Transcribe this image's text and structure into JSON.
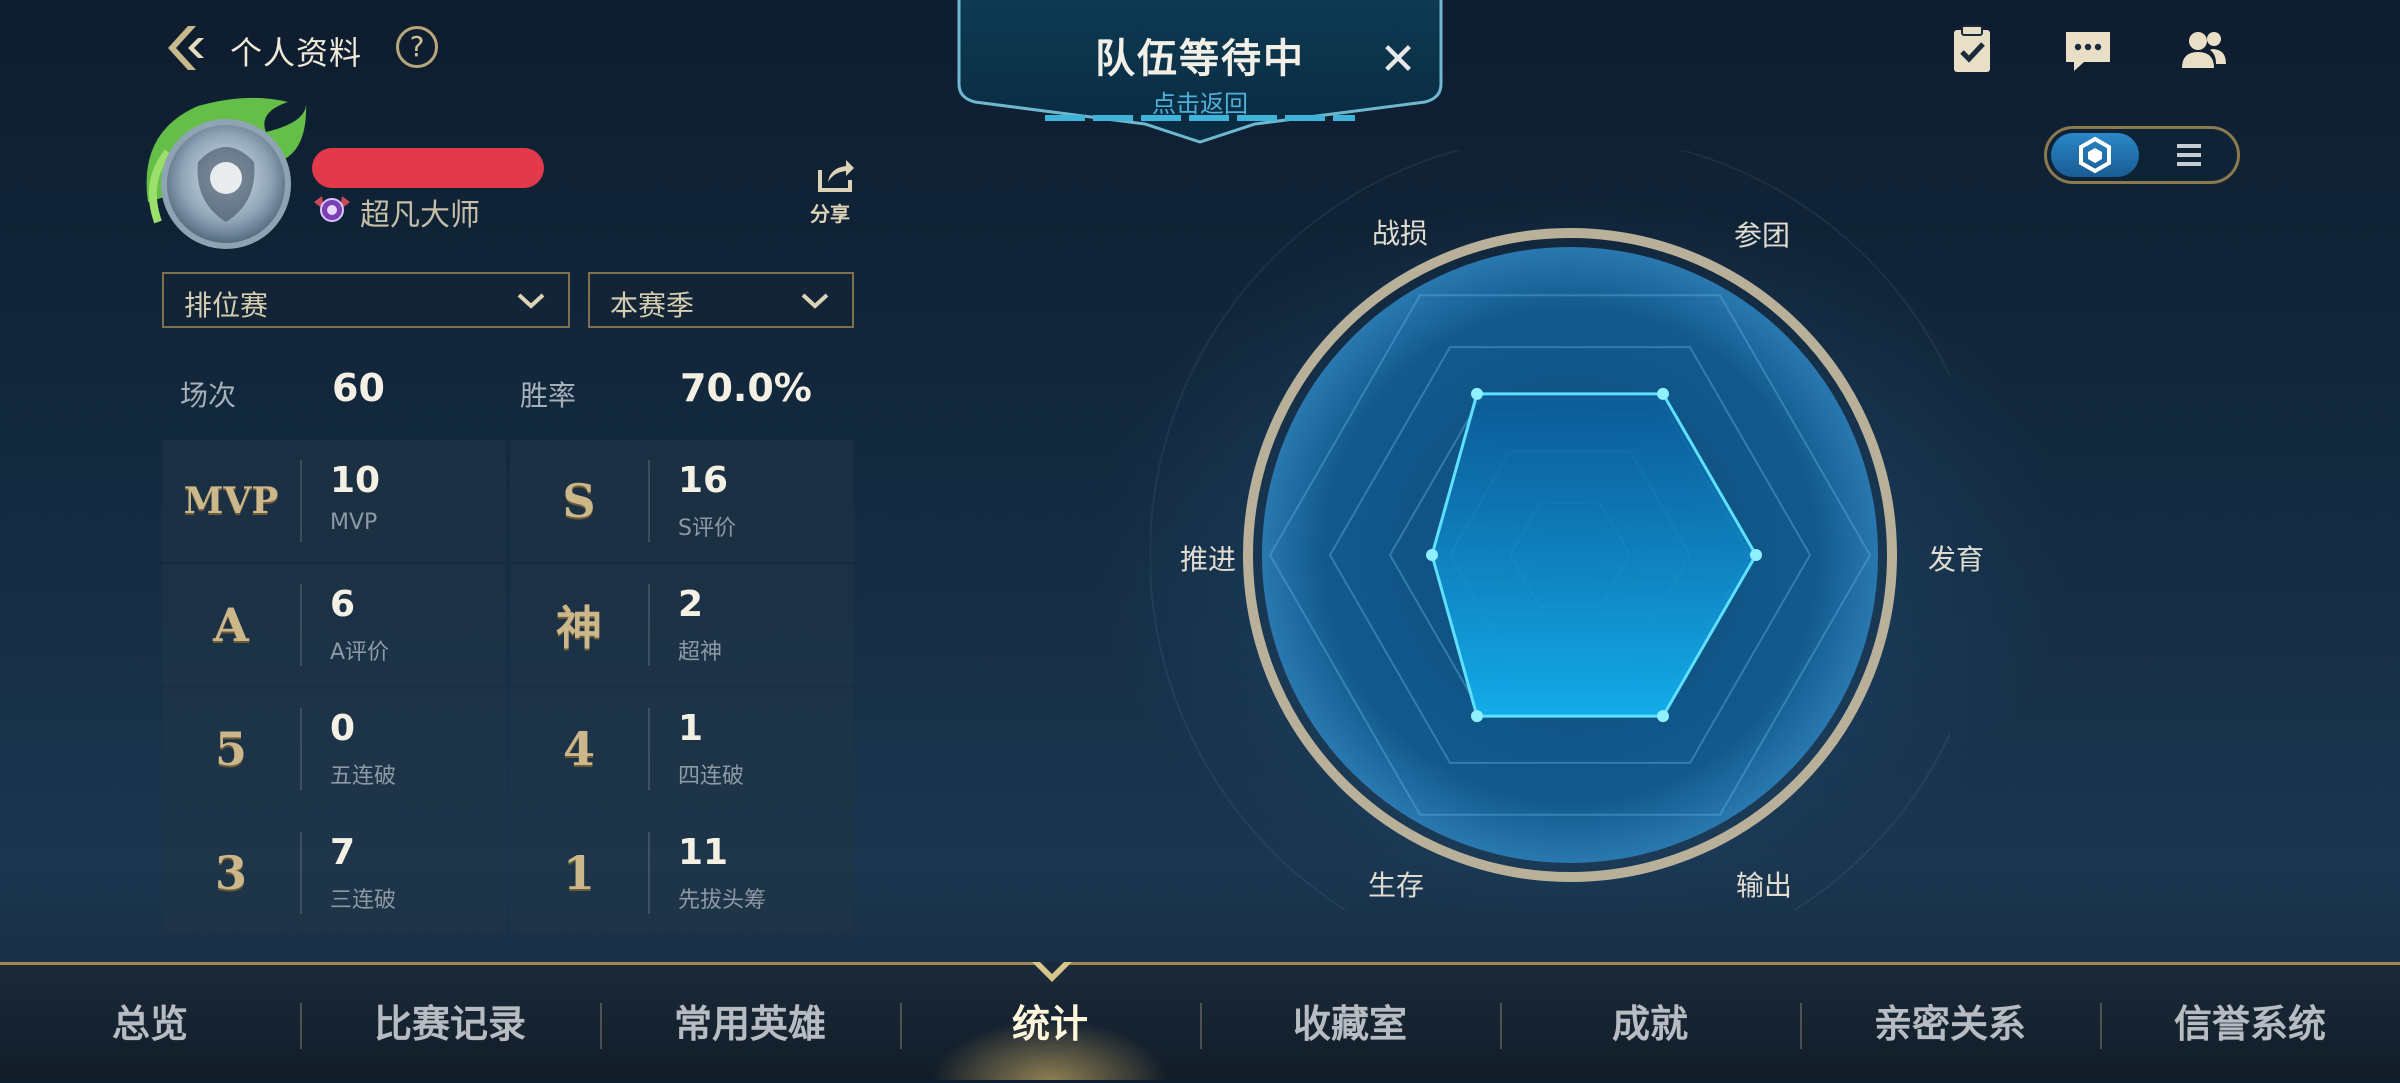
{
  "header": {
    "title": "个人资料",
    "help": "?"
  },
  "queue": {
    "title": "队伍等待中",
    "subtitle": "点击返回",
    "close": "✕"
  },
  "top_icons": [
    "checklist-icon",
    "chat-icon",
    "friends-icon"
  ],
  "profile": {
    "rank": "超凡大师",
    "share": "分享"
  },
  "filters": {
    "mode": "排位赛",
    "season": "本赛季"
  },
  "summary": {
    "games_label": "场次",
    "games_value": "60",
    "winrate_label": "胜率",
    "winrate_value": "70.0%"
  },
  "stats": [
    {
      "badge": "MVP",
      "value": "10",
      "label": "MVP"
    },
    {
      "badge": "S",
      "value": "16",
      "label": "S评价"
    },
    {
      "badge": "A",
      "value": "6",
      "label": "A评价"
    },
    {
      "badge": "神",
      "value": "2",
      "label": "超神"
    },
    {
      "badge": "5",
      "value": "0",
      "label": "五连破"
    },
    {
      "badge": "4",
      "value": "1",
      "label": "四连破"
    },
    {
      "badge": "3",
      "value": "7",
      "label": "三连破"
    },
    {
      "badge": "1",
      "value": "11",
      "label": "先拔头筹"
    }
  ],
  "radar": {
    "axes": [
      "战损",
      "参团",
      "发育",
      "输出",
      "生存",
      "推进"
    ]
  },
  "chart_data": {
    "type": "radar",
    "categories": [
      "战损",
      "参团",
      "发育",
      "输出",
      "生存",
      "推进"
    ],
    "values": [
      0.62,
      0.62,
      0.62,
      0.62,
      0.62,
      0.46
    ],
    "range": [
      0,
      1
    ]
  },
  "nav": {
    "items": [
      "总览",
      "比赛记录",
      "常用英雄",
      "统计",
      "收藏室",
      "成就",
      "亲密关系",
      "信誉系统"
    ],
    "active": "统计"
  },
  "colors": {
    "accent_gold": "#b8a77a",
    "radar_fill": "#1fa6e6",
    "name_redaction": "#e23a4a"
  }
}
